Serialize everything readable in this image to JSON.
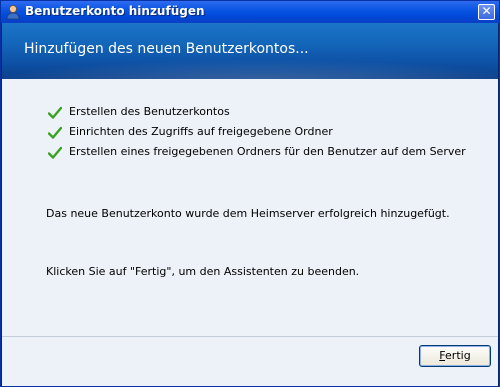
{
  "window": {
    "title": "Benutzerkonto hinzufügen",
    "close_glyph": "✕",
    "title_icon": "user-account-icon"
  },
  "header": {
    "title": "Hinzufügen des neuen Benutzerkontos..."
  },
  "checklist": {
    "items": [
      {
        "label": "Erstellen des Benutzerkontos",
        "status": "done"
      },
      {
        "label": "Einrichten des Zugriffs auf freigegebene Ordner",
        "status": "done"
      },
      {
        "label": "Erstellen eines freigegebenen Ordners für den Benutzer auf dem Server",
        "status": "done"
      }
    ],
    "check_color": "#3aa421"
  },
  "messages": {
    "success": "Das neue Benutzerkonto wurde dem Heimserver erfolgreich hinzugefügt.",
    "instruction": "Klicken Sie auf \"Fertig\", um den Assistenten zu beenden."
  },
  "footer": {
    "finish_label": "Fertig"
  }
}
